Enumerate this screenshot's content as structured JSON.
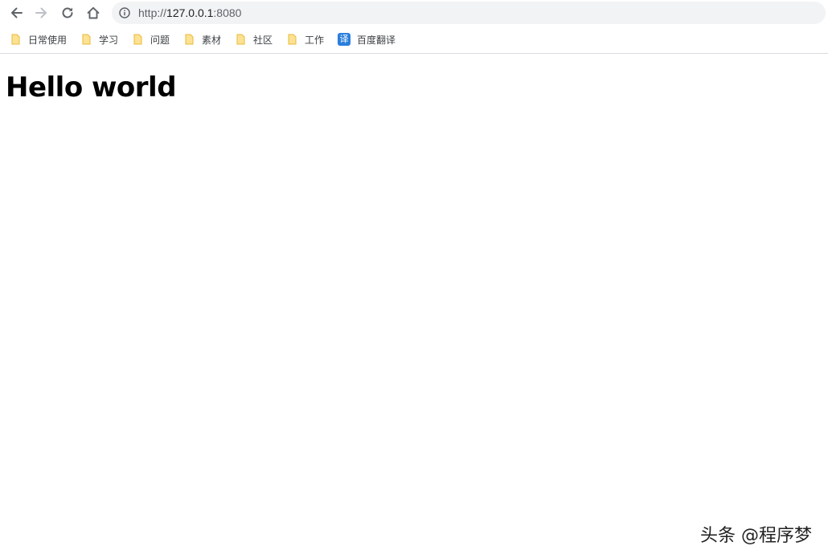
{
  "nav": {
    "back_icon": "arrow-left-icon",
    "forward_icon": "arrow-right-icon",
    "reload_icon": "reload-icon",
    "home_icon": "home-icon"
  },
  "omnibox": {
    "info_icon": "info-icon",
    "url_scheme": "http://",
    "url_host": "127.0.0.1",
    "url_port": ":8080"
  },
  "bookmarks": [
    {
      "label": "日常使用",
      "icon": "folder-icon"
    },
    {
      "label": "学习",
      "icon": "folder-icon"
    },
    {
      "label": "问题",
      "icon": "folder-icon"
    },
    {
      "label": "素材",
      "icon": "folder-icon"
    },
    {
      "label": "社区",
      "icon": "folder-icon"
    },
    {
      "label": "工作",
      "icon": "folder-icon"
    },
    {
      "label": "百度翻译",
      "icon": "fanyi-icon",
      "icon_text": "译"
    }
  ],
  "page": {
    "heading": "Hello world"
  },
  "watermark": {
    "text": "头条 @程序梦"
  },
  "colors": {
    "omnibox_bg": "#f1f3f4",
    "folder_fill": "#fde293",
    "folder_stroke": "#e8b93a",
    "fanyi_bg": "#2b7fdc",
    "icon_gray": "#5f6368"
  }
}
